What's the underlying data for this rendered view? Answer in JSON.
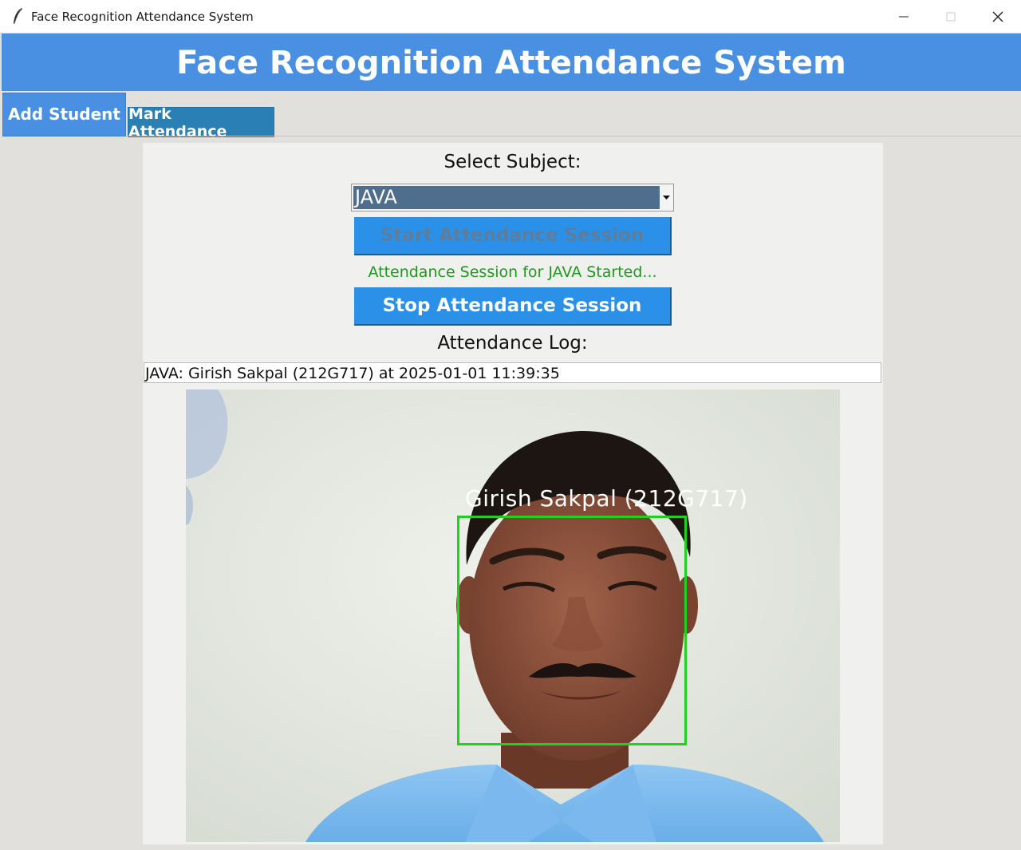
{
  "window": {
    "title": "Face Recognition Attendance System",
    "controls": {
      "minimize_icon": "minimize-icon",
      "maximize_icon": "maximize-icon",
      "close_icon": "close-icon"
    }
  },
  "header": {
    "title": "Face Recognition Attendance System",
    "background": "#4a90e2"
  },
  "tabs": [
    {
      "label": "Add Student",
      "selected": false
    },
    {
      "label": "Mark Attendance",
      "selected": true
    }
  ],
  "mark_attendance": {
    "subject_label": "Select Subject:",
    "subject_selected": "JAVA",
    "start_button": "Start Attendance Session",
    "start_button_enabled": false,
    "status": "Attendance Session for JAVA Started...",
    "status_color": "#1f9a1f",
    "stop_button": "Stop Attendance Session",
    "log_label": "Attendance Log:",
    "log_entries": [
      "JAVA: Girish Sakpal (212G717) at 2025-01-01 11:39:35"
    ],
    "camera": {
      "detected_label": "Girish Sakpal (212G717)",
      "box_color": "#22d020"
    }
  },
  "colors": {
    "button_blue": "#2b91e8",
    "tab_active": "#2a7fb4",
    "window_bg": "#e1e0dc"
  }
}
